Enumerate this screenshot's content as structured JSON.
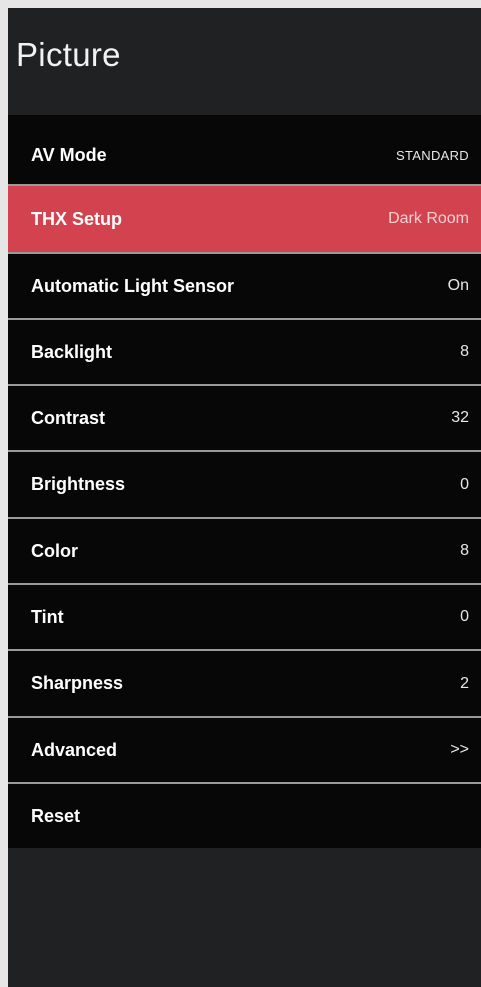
{
  "header": {
    "title": "Picture"
  },
  "menu": {
    "items": [
      {
        "label": "AV Mode",
        "value": "STANDARD"
      },
      {
        "label": "THX Setup",
        "value": "Dark Room",
        "selected": true
      },
      {
        "label": "Automatic Light Sensor",
        "value": "On"
      },
      {
        "label": "Backlight",
        "value": "8"
      },
      {
        "label": "Contrast",
        "value": "32"
      },
      {
        "label": "Brightness",
        "value": "0"
      },
      {
        "label": "Color",
        "value": "8"
      },
      {
        "label": "Tint",
        "value": "0"
      },
      {
        "label": "Sharpness",
        "value": "2"
      },
      {
        "label": "Advanced",
        "value": ">>"
      },
      {
        "label": "Reset",
        "value": ""
      }
    ]
  },
  "colors": {
    "highlight": "#d2434f",
    "panel_background": "#202122",
    "menu_background": "#070708",
    "outer_background": "#e6e6e6",
    "divider": "#9a9a9a"
  }
}
